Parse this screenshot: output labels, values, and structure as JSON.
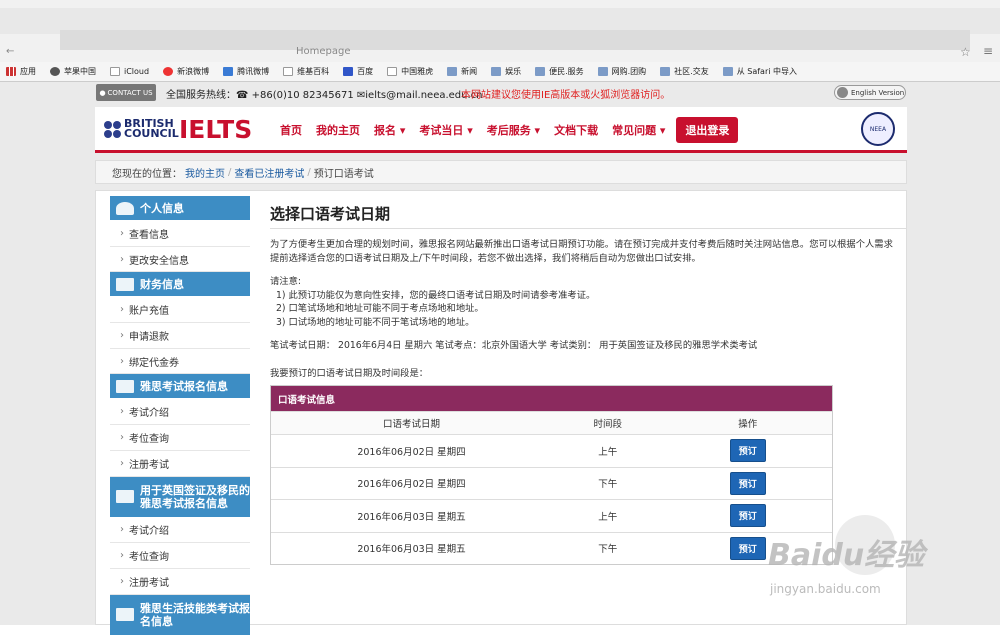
{
  "browser": {
    "url_fragment": "Homepage",
    "bookmarks": [
      {
        "label": "应用",
        "icon": "grid"
      },
      {
        "label": "苹果中国",
        "icon": "apple"
      },
      {
        "label": "iCloud",
        "icon": "doc"
      },
      {
        "label": "新浪微博",
        "icon": "weibo"
      },
      {
        "label": "腾讯微博",
        "icon": "blue"
      },
      {
        "label": "维基百科",
        "icon": "doc"
      },
      {
        "label": "百度",
        "icon": "paw"
      },
      {
        "label": "中国雅虎",
        "icon": "doc"
      },
      {
        "label": "新闻",
        "icon": "folder"
      },
      {
        "label": "娱乐",
        "icon": "folder"
      },
      {
        "label": "便民.服务",
        "icon": "folder"
      },
      {
        "label": "网购.团购",
        "icon": "folder"
      },
      {
        "label": "社区.交友",
        "icon": "folder"
      },
      {
        "label": "从 Safari 中导入",
        "icon": "folder"
      }
    ]
  },
  "topbar": {
    "contact_label": "CONTACT US",
    "hotline": "全国服务热线：☎ +86(0)10 82345671 ✉ielts@mail.neea.edu.cn",
    "warning": "本网站建议您使用IE高版本或火狐浏览器访问。",
    "english_version": "English Version"
  },
  "header": {
    "bc_line1": "BRITISH",
    "bc_line2": "COUNCIL",
    "ielts": "IELTS",
    "seal_text": "NEEA",
    "nav": [
      "首页",
      "我的主页",
      "报名 ▾",
      "考试当日 ▾",
      "考后服务 ▾",
      "文档下载",
      "常见问题 ▾"
    ],
    "logout": "退出登录"
  },
  "breadcrumb": {
    "prefix": "您现在的位置：",
    "home": "我的主页",
    "registered": "查看已注册考试",
    "current": "预订口语考试"
  },
  "sidebar": {
    "personal": {
      "title": "个人信息",
      "items": [
        "查看信息",
        "更改安全信息"
      ]
    },
    "finance": {
      "title": "财务信息",
      "items": [
        "账户充值",
        "申请退款",
        "绑定代金券"
      ]
    },
    "ielts": {
      "title": "雅思考试报名信息",
      "items": [
        "考试介绍",
        "考位查询",
        "注册考试"
      ]
    },
    "ukvi": {
      "title": "用于英国签证及移民的雅思考试报名信息",
      "items": [
        "考试介绍",
        "考位查询",
        "注册考试"
      ]
    },
    "life": {
      "title": "雅思生活技能类考试报名信息"
    }
  },
  "main": {
    "title": "选择口语考试日期",
    "intro": "为了方便考生更加合理的规划时间，雅思报名网站最新推出口语考试日期预订功能。请在预订完成并支付考费后随时关注网站信息。您可以根据个人需求提前选择适合您的口语考试日期及上/下午时间段，若您不做出选择，我们将稍后自动为您做出口试安排。",
    "notes_title": "请注意:",
    "notes": [
      "1) 此预订功能仅为意向性安排，您的最终口语考试日期及时间请参考准考证。",
      "2) 口笔试场地和地址可能不同于考点场地和地址。",
      "3) 口试场地的地址可能不同于笔试场地的地址。"
    ],
    "exam_info": "笔试考试日期： 2016年6月4日 星期六   笔试考点：北京外国语大学   考试类别： 用于英国签证及移民的雅思学术类考试",
    "choose_label": "我要预订的口语考试日期及时间段是："
  },
  "table": {
    "title": "口语考试信息",
    "columns": [
      "口语考试日期",
      "时间段",
      "操作"
    ],
    "rows": [
      {
        "date": "2016年06月02日 星期四",
        "period": "上午",
        "action": "预订"
      },
      {
        "date": "2016年06月02日 星期四",
        "period": "下午",
        "action": "预订"
      },
      {
        "date": "2016年06月03日 星期五",
        "period": "上午",
        "action": "预订"
      },
      {
        "date": "2016年06月03日 星期五",
        "period": "下午",
        "action": "预订"
      }
    ]
  },
  "watermark": {
    "main": "Baidu经验",
    "sub": "jingyan.baidu.com"
  }
}
